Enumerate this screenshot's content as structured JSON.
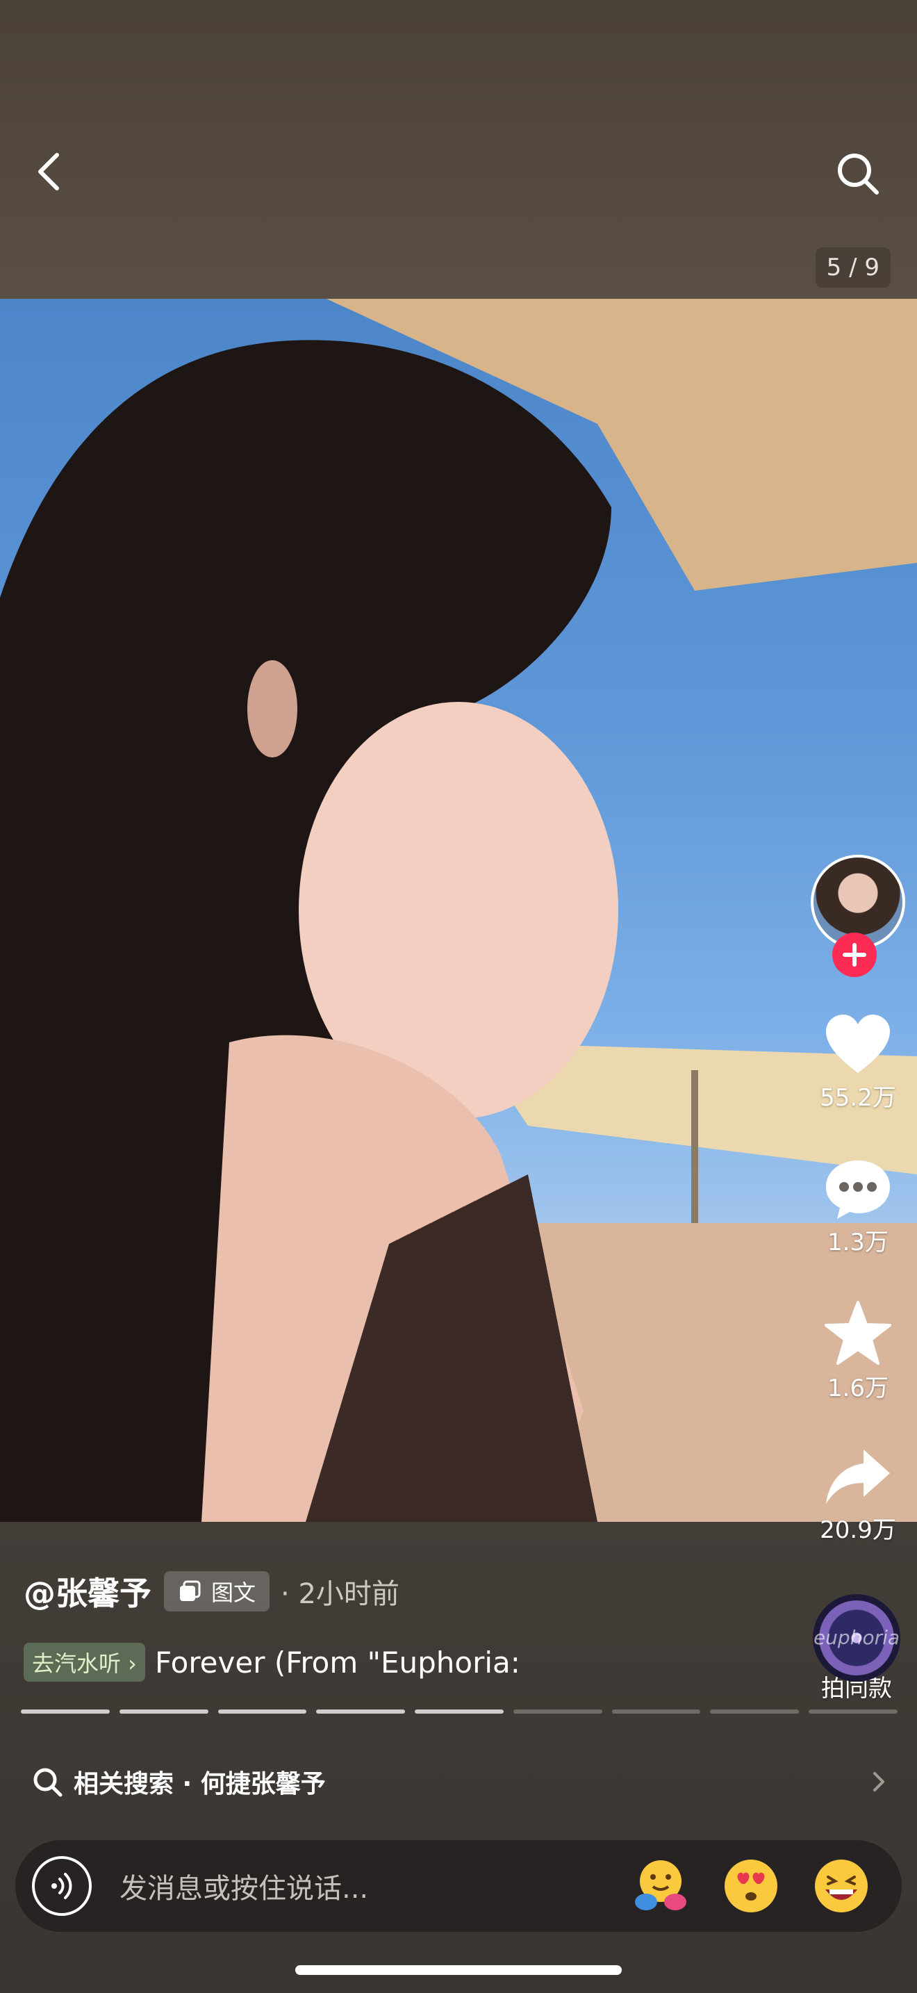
{
  "header": {
    "page_counter": "5 / 9"
  },
  "rail": {
    "likes": "55.2万",
    "comments": "1.3万",
    "favorites": "1.6万",
    "shares": "20.9万"
  },
  "post": {
    "author": "@张馨予",
    "type_badge": "图文",
    "time": "· 2小时前",
    "music_tag": "去汽水听 ›",
    "music_title": "Forever (From \"Euphoria:",
    "same_model_label": "拍同款",
    "disc_text": "euphoria",
    "progress": {
      "current": 5,
      "total": 9
    }
  },
  "related_search": {
    "label": "相关搜索 · 何捷张馨予"
  },
  "input": {
    "placeholder": "发消息或按住说话..."
  },
  "colors": {
    "accent_follow": "#fe2c55",
    "music_tag_bg": "#5d6a55"
  }
}
